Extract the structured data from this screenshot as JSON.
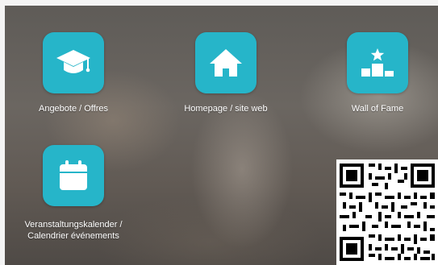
{
  "tiles": [
    {
      "label": "Angebote / Offres",
      "icon": "graduation-cap-icon"
    },
    {
      "label": "Homepage / site web",
      "icon": "home-icon"
    },
    {
      "label": "Wall of Fame",
      "icon": "podium-star-icon"
    },
    {
      "label_line1": "Veranstaltungskalender /",
      "label_line2": "Calendrier événements",
      "icon": "calendar-icon"
    }
  ],
  "colors": {
    "tile_accent": "#26b5c9",
    "label_text": "#ffffff"
  },
  "qr_code": {
    "icon": "qr-code-icon"
  }
}
